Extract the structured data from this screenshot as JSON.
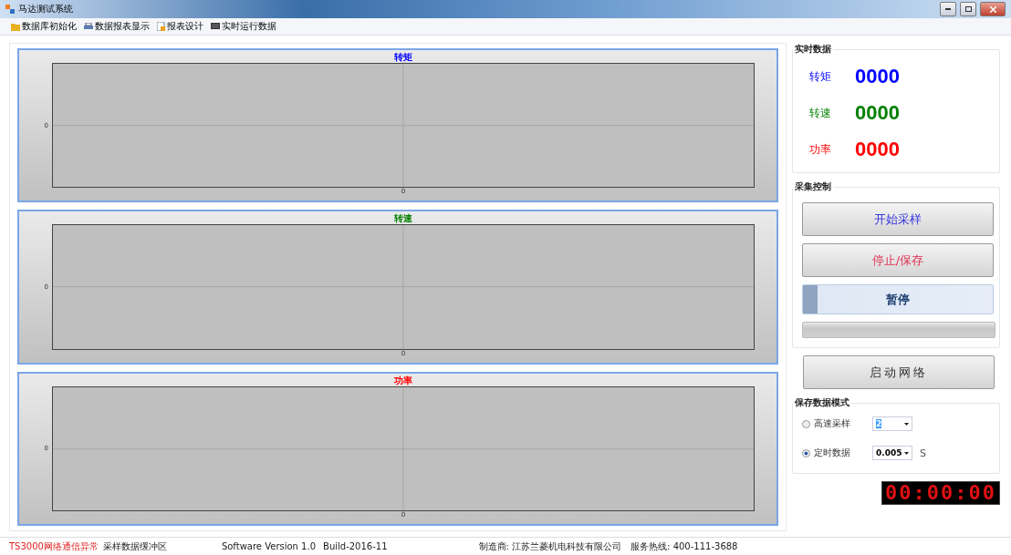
{
  "window": {
    "title": "马达测试系统"
  },
  "menu": [
    {
      "label": "数据库初始化"
    },
    {
      "label": "数据报表显示"
    },
    {
      "label": "报表设计"
    },
    {
      "label": "实时运行数据"
    }
  ],
  "charts": [
    {
      "title": "转矩",
      "color": "#0000ff",
      "y_tick": "0",
      "x_tick": "0"
    },
    {
      "title": "转速",
      "color": "#008000",
      "y_tick": "0",
      "x_tick": "0"
    },
    {
      "title": "功率",
      "color": "#ff0000",
      "y_tick": "0",
      "x_tick": "0"
    }
  ],
  "realtime": {
    "title": "实时数据",
    "items": [
      {
        "label": "转矩",
        "value": "0000",
        "color": "#0000ff"
      },
      {
        "label": "转速",
        "value": "0000",
        "color": "#008000"
      },
      {
        "label": "功率",
        "value": "0000",
        "color": "#ff0000"
      }
    ]
  },
  "acquisition": {
    "title": "采集控制",
    "buttons": [
      {
        "label": "开始采样",
        "color": "#3030e0"
      },
      {
        "label": "停止/保存",
        "color": "#e03050"
      },
      {
        "label": "暂停",
        "color": "#1f3f70"
      }
    ],
    "progress": {
      "level": 0
    }
  },
  "network_button": "启动网络",
  "save_mode": {
    "title": "保存数据模式",
    "options": [
      {
        "label": "高速采样",
        "selected": false,
        "value": "2",
        "value_highlighted": true
      },
      {
        "label": "定时数据",
        "selected": true,
        "value": "0.005",
        "value_highlighted": false,
        "unit": "S"
      }
    ]
  },
  "clock": "00:00:00",
  "status_bar": {
    "error": "TS3000网络通信异常",
    "buffer": "采样数据缓冲区",
    "version": "Software Version 1.0",
    "build": "Build-2016-11",
    "maker": "制造商: 江苏兰菱机电科技有限公司",
    "hotline": "服务热线: 400-111-3688"
  }
}
